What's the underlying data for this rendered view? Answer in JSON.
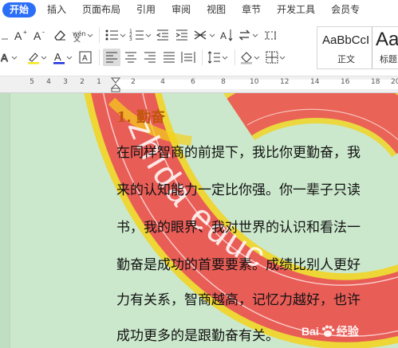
{
  "menubar": {
    "items": [
      {
        "label": "开始",
        "active": true
      },
      {
        "label": "插入"
      },
      {
        "label": "页面布局"
      },
      {
        "label": "引用"
      },
      {
        "label": "审阅"
      },
      {
        "label": "视图"
      },
      {
        "label": "章节"
      },
      {
        "label": "开发工具"
      },
      {
        "label": "会员专"
      }
    ]
  },
  "styles": {
    "normal": {
      "sample": "AaBbCcI",
      "name": "正文"
    },
    "heading": {
      "sample": "Aa",
      "name": "标题"
    }
  },
  "ruler": {
    "left_numbers": [
      "5",
      "4",
      "3",
      "2",
      "1"
    ],
    "right_numbers": [
      "2",
      "4",
      "6",
      "8",
      "10",
      "12",
      "14",
      "16",
      "18",
      "20"
    ]
  },
  "document": {
    "heading": "1. 勤奋",
    "lines": [
      "在同样智商的前提下，我比你更勤奋，我",
      "来的认知能力一定比你强。你一辈子只读",
      "书，我的眼界、我对世界的认识和看法一",
      "勤奋是成功的首要要素。成绩比别人更好",
      "力有关系，智商越高，记忆力越好，也许",
      "成功更多的是跟勤奋有关。"
    ],
    "watermark_text": "zhida educ"
  },
  "baidu_watermark": {
    "left": "Bai",
    "right": "经验"
  },
  "colors": {
    "accent": "#2b6ef7",
    "page_background": "#cbe8cc",
    "heading_color": "#c0560a",
    "watermark_red": "#e8535a",
    "watermark_yellow": "#f3d21a"
  }
}
